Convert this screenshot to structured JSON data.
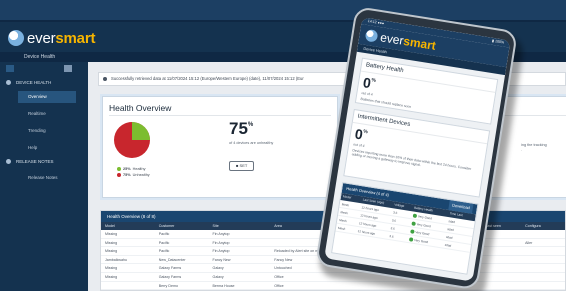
{
  "brand": {
    "name_part1": "ever",
    "name_part2": "smart",
    "accent": "#f7b500",
    "navy": "#14324f"
  },
  "desktop": {
    "subtitle": "Device Health",
    "sidebar": {
      "sections": [
        {
          "label": "DEVICE HEALTH",
          "items": [
            "Overview",
            "Realtime",
            "Trending",
            "Help"
          ]
        },
        {
          "label": "RELEASE NOTES",
          "items": [
            "Release Notes"
          ]
        }
      ],
      "active_item": "Overview"
    },
    "notice": "Successfully retrieved data at 11/07/2024 15:12 (Europe/Western Europe) (date), 11/07/2024 15:12 (Eur",
    "health_overview": {
      "title": "Health Overview",
      "percent": "75",
      "percent_sign": "%",
      "caption": "of 4 devices are unhealthy",
      "legend": [
        {
          "pct": "25%",
          "label": "Healthy",
          "color": "#7cbd2f"
        },
        {
          "pct": "75%",
          "label": "Unhealthy",
          "color": "#c8262d"
        }
      ],
      "set_button": "SET",
      "pie": {
        "healthy_fraction": 0.25
      }
    },
    "second_card": {
      "title": "Mo",
      "percent": "75",
      "caption_lines": [
        "Devic",
        "the las",
        "a gatew"
      ],
      "caption_right": [
        "ing the tracking",
        "."
      ]
    },
    "table": {
      "title": "Health Overview (8 of 8)",
      "columns": [
        "Model",
        "Customer",
        "Site",
        "Area",
        "",
        "",
        "",
        "Last seen",
        "Configura"
      ],
      "rows": [
        [
          "Missing",
          "Pacific",
          "Fin Anytop",
          "",
          "",
          "",
          "",
          "",
          ""
        ],
        [
          "Missing",
          "Pacific",
          "Fin Anytop",
          "",
          "",
          "",
          "",
          "",
          "Aller"
        ],
        [
          "Missing",
          "Pacific",
          "Fin Anytop",
          "Reloaded by Alert site on mobile",
          "",
          "",
          "",
          "",
          ""
        ],
        [
          "Jambalkwahu",
          "New_Datacenter",
          "Fancy New",
          "Fancy New",
          "",
          "",
          "",
          "",
          ""
        ],
        [
          "Missing",
          "Galaxy Farms",
          "Galaxy",
          "Untouched",
          "",
          "",
          "",
          "",
          ""
        ],
        [
          "Missing",
          "Galaxy Farms",
          "Galaxy",
          "Office",
          "",
          "",
          "",
          "",
          ""
        ],
        [
          "",
          "Berry Demo",
          "Berma House",
          "Office",
          "",
          "",
          "",
          "",
          ""
        ]
      ]
    }
  },
  "phone": {
    "status_left": "14:12 ●●●",
    "status_right": "▮ 100%",
    "subtitle": "Device Health",
    "battery_card": {
      "title": "Battery Health",
      "percent": "0",
      "percent_sign": "%",
      "sub": "out of 4",
      "desc": "Batteries that should replace soon"
    },
    "intermittent_card": {
      "title": "Intermittent Devices",
      "percent": "0",
      "percent_sign": "%",
      "sub": "out of 4",
      "desc": "Devices reporting more than 10% of their data within the last 24 hours. Consider adding or moving a gateway to improve signal."
    },
    "table": {
      "title": "Health Overview (4 of 4)",
      "download": "Download",
      "columns": [
        "Model",
        "Last Seen (Ago)",
        "Voltage",
        "Battery Health",
        "Time Last"
      ],
      "rows": [
        [
          "Mesh",
          "12 hours ago",
          "3.6",
          "Very Good",
          "sdad"
        ],
        [
          "Mesh",
          "12 hours ago",
          "3.6",
          "Very Good",
          "sdad"
        ],
        [
          "Mesh",
          "12 hours ago",
          "3.6",
          "Very Good",
          "sdad"
        ],
        [
          "Mesh",
          "12 hours ago",
          "3.6",
          "Very Good",
          "sdad"
        ]
      ]
    }
  }
}
